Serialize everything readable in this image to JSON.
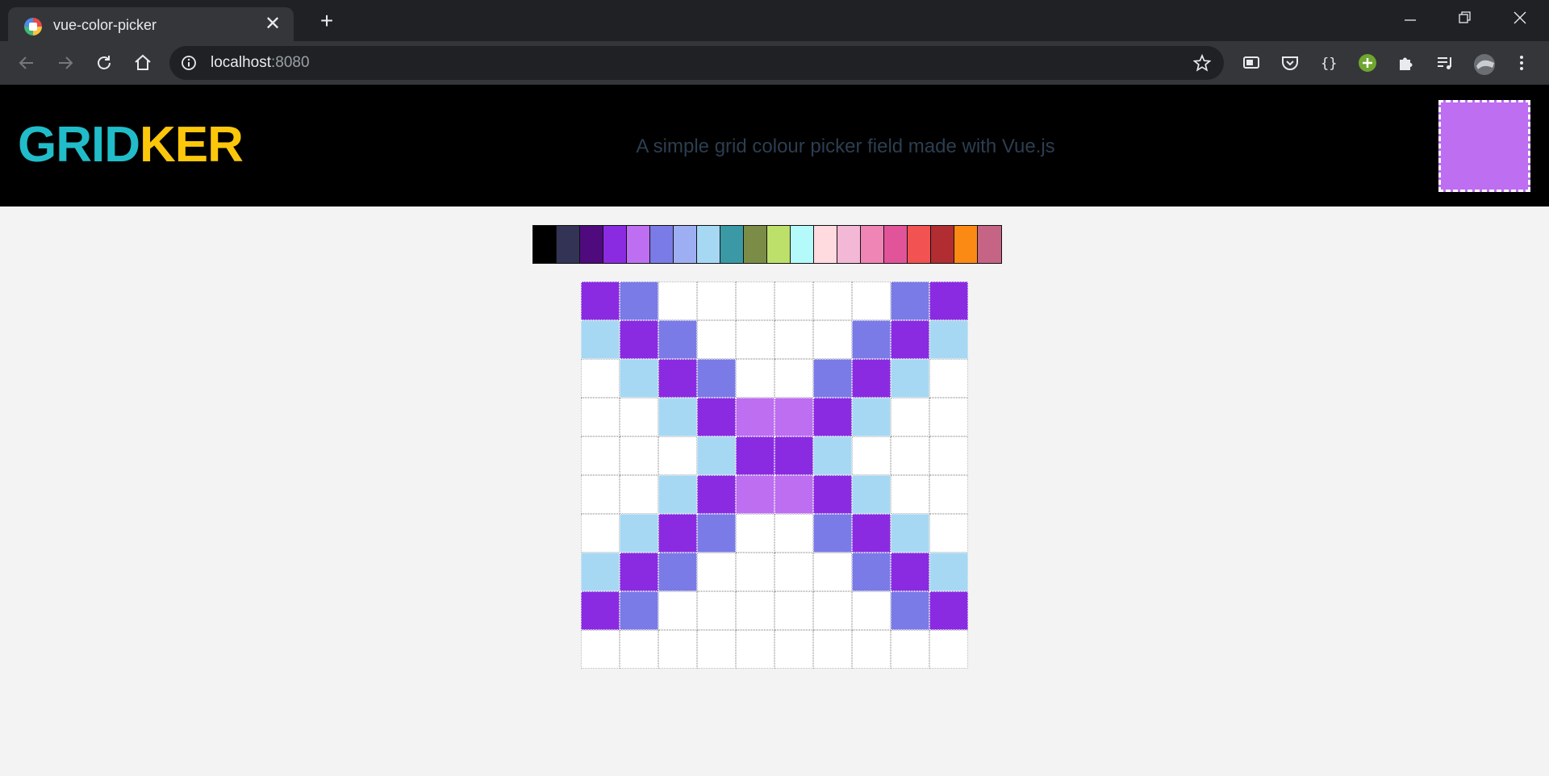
{
  "browser": {
    "tab_title": "vue-color-picker",
    "url_host": "localhost",
    "url_port": ":8080"
  },
  "header": {
    "logo_part1": "GRID",
    "logo_part2": "KER",
    "tagline": "A simple grid colour picker field made with Vue.js",
    "selected_color": "#bd6ef1"
  },
  "palette": [
    "#000000",
    "#333355",
    "#4f0a7d",
    "#8a2be2",
    "#bd6ef1",
    "#7a7be7",
    "#9daef3",
    "#a6d8f4",
    "#3a99a5",
    "#7b8c46",
    "#bce06a",
    "#b4fafb",
    "#ffdadf",
    "#f4b8d7",
    "#ee85b4",
    "#e2549a",
    "#f25252",
    "#b12d31",
    "#fb8a14",
    "#c66486"
  ],
  "grid": {
    "rows": [
      [
        "#8a2be2",
        "#7a7be7",
        "#ffffff",
        "#ffffff",
        "#ffffff",
        "#ffffff",
        "#ffffff",
        "#ffffff",
        "#7a7be7",
        "#8a2be2"
      ],
      [
        "#a6d8f4",
        "#8a2be2",
        "#7a7be7",
        "#ffffff",
        "#ffffff",
        "#ffffff",
        "#ffffff",
        "#7a7be7",
        "#8a2be2",
        "#a6d8f4"
      ],
      [
        "#ffffff",
        "#a6d8f4",
        "#8a2be2",
        "#7a7be7",
        "#ffffff",
        "#ffffff",
        "#7a7be7",
        "#8a2be2",
        "#a6d8f4",
        "#ffffff"
      ],
      [
        "#ffffff",
        "#ffffff",
        "#a6d8f4",
        "#8a2be2",
        "#bd6ef1",
        "#bd6ef1",
        "#8a2be2",
        "#a6d8f4",
        "#ffffff",
        "#ffffff"
      ],
      [
        "#ffffff",
        "#ffffff",
        "#ffffff",
        "#a6d8f4",
        "#8a2be2",
        "#8a2be2",
        "#a6d8f4",
        "#ffffff",
        "#ffffff",
        "#ffffff"
      ],
      [
        "#ffffff",
        "#ffffff",
        "#a6d8f4",
        "#8a2be2",
        "#bd6ef1",
        "#bd6ef1",
        "#8a2be2",
        "#a6d8f4",
        "#ffffff",
        "#ffffff"
      ],
      [
        "#ffffff",
        "#a6d8f4",
        "#8a2be2",
        "#7a7be7",
        "#ffffff",
        "#ffffff",
        "#7a7be7",
        "#8a2be2",
        "#a6d8f4",
        "#ffffff"
      ],
      [
        "#a6d8f4",
        "#8a2be2",
        "#7a7be7",
        "#ffffff",
        "#ffffff",
        "#ffffff",
        "#ffffff",
        "#7a7be7",
        "#8a2be2",
        "#a6d8f4"
      ],
      [
        "#8a2be2",
        "#7a7be7",
        "#ffffff",
        "#ffffff",
        "#ffffff",
        "#ffffff",
        "#ffffff",
        "#ffffff",
        "#7a7be7",
        "#8a2be2"
      ],
      [
        "#ffffff",
        "#ffffff",
        "#ffffff",
        "#ffffff",
        "#ffffff",
        "#ffffff",
        "#ffffff",
        "#ffffff",
        "#ffffff",
        "#ffffff"
      ]
    ]
  }
}
